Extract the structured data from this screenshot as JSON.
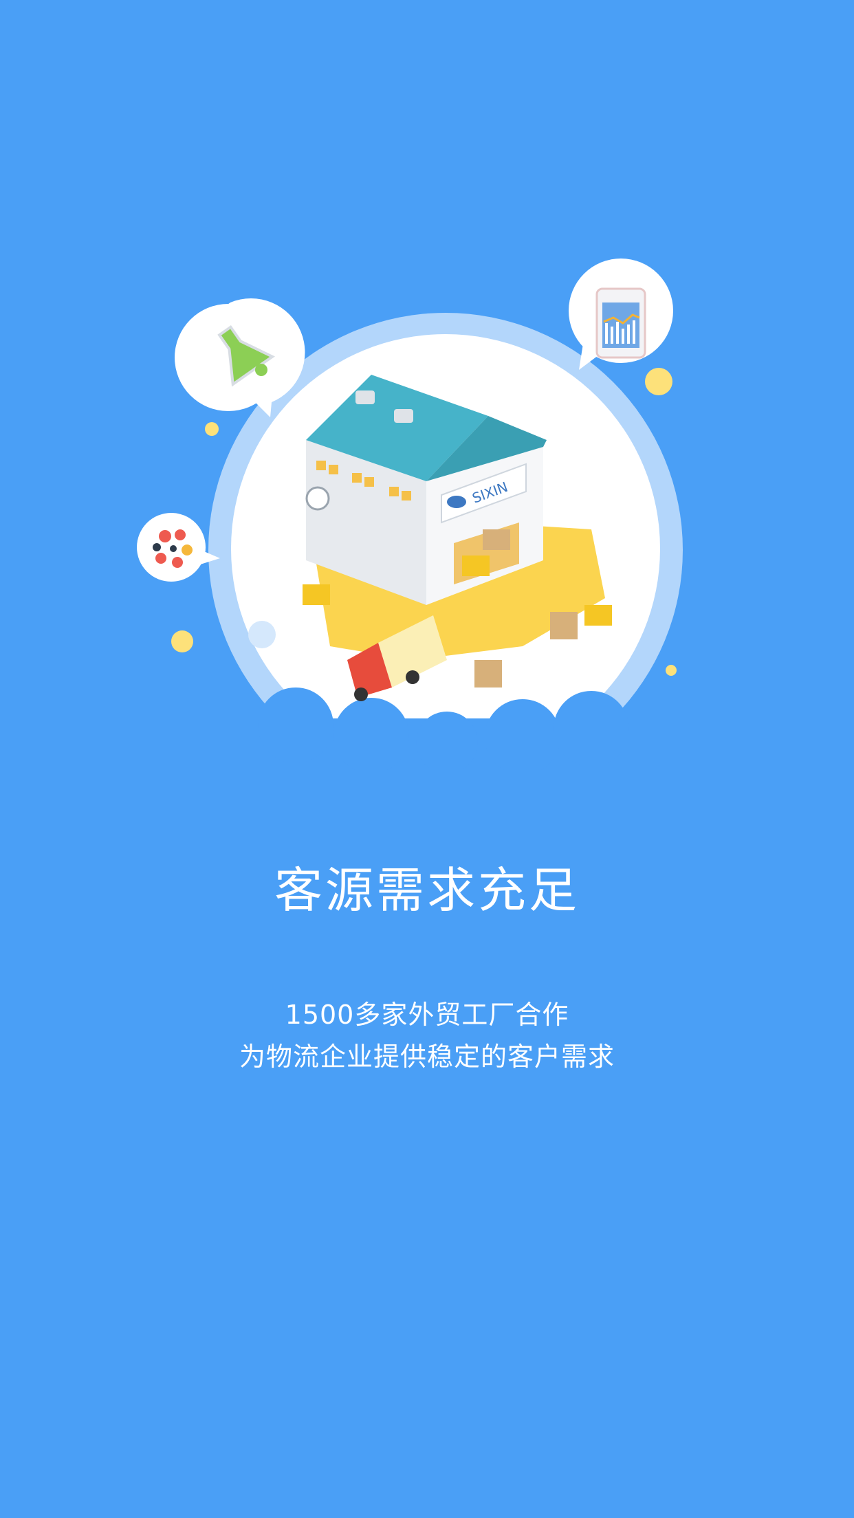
{
  "onboarding": {
    "title": "客源需求充足",
    "description_line1": "1500多家外贸工厂合作",
    "description_line2": "为物流企业提供稳定的客户需求",
    "illustration": {
      "sign_text": "SIXIN",
      "icons": [
        "flask-icon",
        "chart-phone-icon",
        "molecule-icon",
        "warehouse-icon",
        "truck-icon",
        "forklift-icon"
      ]
    }
  },
  "colors": {
    "background": "#4a9ff6",
    "ring": "#b3d6fb",
    "roof": "#46b3c9",
    "accent_yellow": "#fde17a"
  }
}
